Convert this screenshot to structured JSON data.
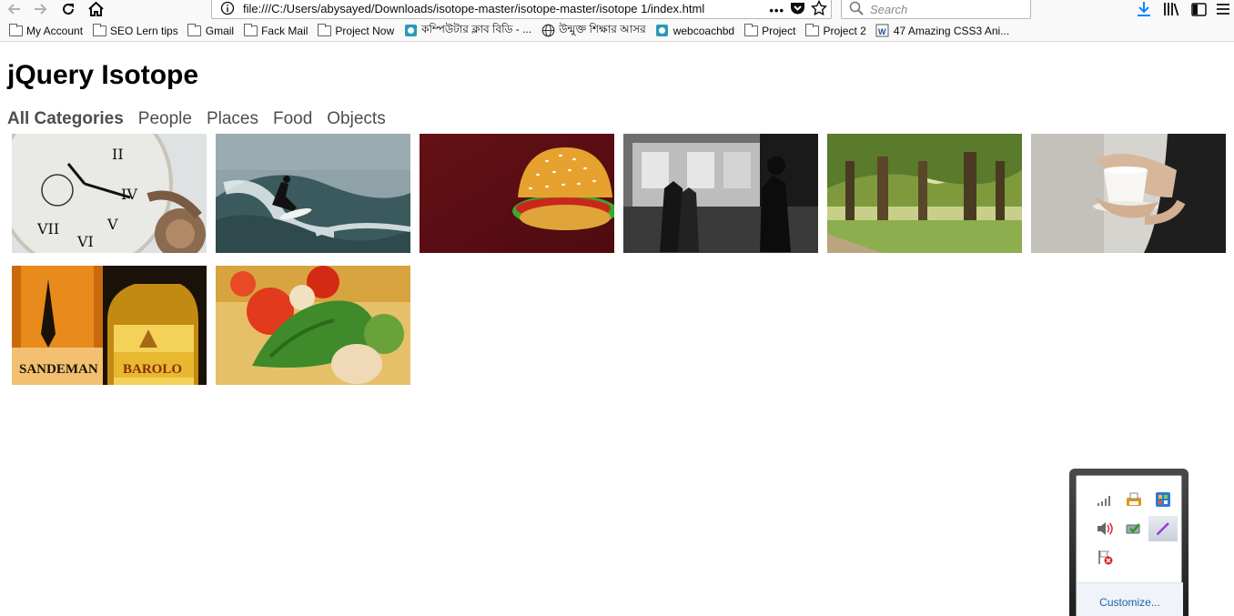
{
  "browser": {
    "url": "file:///C:/Users/abysayed/Downloads/isotope-master/isotope-master/isotope 1/index.html",
    "search_placeholder": "Search",
    "page_actions": "•••"
  },
  "bookmarks": [
    {
      "label": "My Account",
      "icon": "folder-icon"
    },
    {
      "label": "SEO Lern tips",
      "icon": "folder-icon"
    },
    {
      "label": "Gmail",
      "icon": "folder-icon"
    },
    {
      "label": "Fack Mail",
      "icon": "folder-icon"
    },
    {
      "label": "Project Now",
      "icon": "folder-icon"
    },
    {
      "label": "কম্পিউটার ক্লাব বিডি - ...",
      "icon": "site-icon"
    },
    {
      "label": "উন্মুক্ত শিক্ষার আসর",
      "icon": "globe-icon"
    },
    {
      "label": "webcoachbd",
      "icon": "site-icon"
    },
    {
      "label": "Project",
      "icon": "folder-icon"
    },
    {
      "label": "Project 2",
      "icon": "folder-icon"
    },
    {
      "label": "47 Amazing CSS3 Ani...",
      "icon": "word-icon"
    }
  ],
  "page": {
    "title": "jQuery Isotope",
    "filters": [
      {
        "label": "All Categories",
        "active": true
      },
      {
        "label": "People",
        "active": false
      },
      {
        "label": "Places",
        "active": false
      },
      {
        "label": "Food",
        "active": false
      },
      {
        "label": "Objects",
        "active": false
      }
    ]
  },
  "gallery": [
    {
      "name": "pocket-watch-image"
    },
    {
      "name": "surfer-image"
    },
    {
      "name": "burger-image"
    },
    {
      "name": "subway-train-image"
    },
    {
      "name": "tree-lined-path-image"
    },
    {
      "name": "espresso-cup-image"
    },
    {
      "name": "wine-bottles-image",
      "bottle_labels": [
        "SANDEMAN",
        "BAROLO"
      ]
    },
    {
      "name": "vegetables-image"
    }
  ],
  "tray": {
    "icons": [
      "network-signal-icon",
      "printer-icon",
      "windows-update-icon",
      "volume-icon",
      "battery-check-icon",
      "pen-tool-icon",
      "flag-error-icon"
    ],
    "customize_label": "Customize..."
  },
  "colors": {
    "filter_text": "#4d4d4d",
    "customize_link": "#1d5ea8",
    "download_icon": "#0a84ff"
  }
}
